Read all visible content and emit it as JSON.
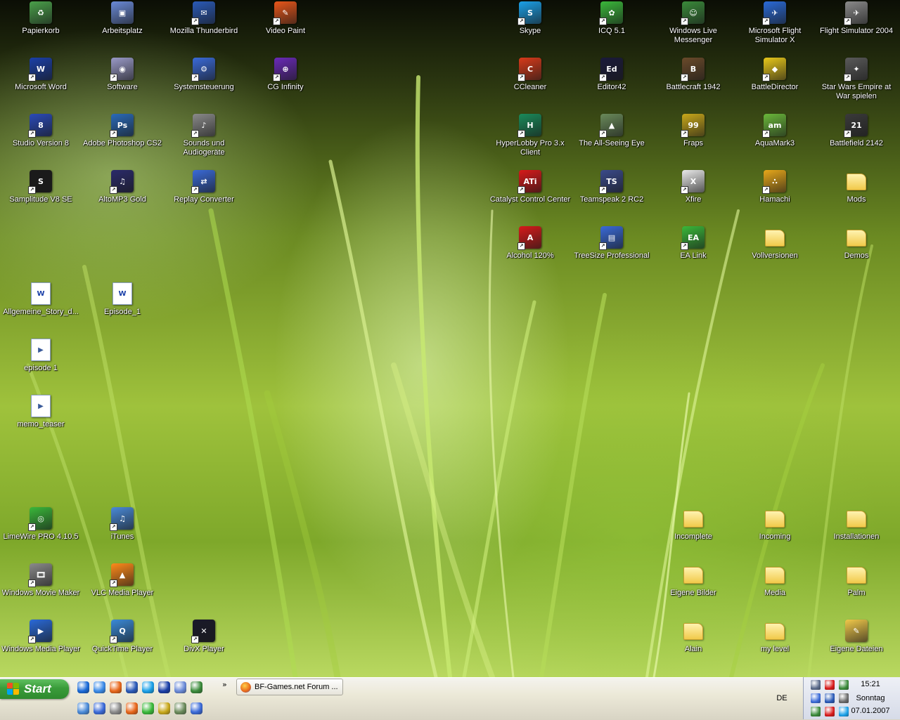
{
  "desktop": {
    "left_icons": [
      {
        "label": "Papierkorb",
        "kind": "recycle",
        "color": "#4aa04a"
      },
      {
        "label": "Arbeitsplatz",
        "kind": "computer",
        "color": "#6a8ad8"
      },
      {
        "label": "Mozilla Thunderbird",
        "kind": "thunderbird",
        "color": "#2a5ab8"
      },
      {
        "label": "Video Paint",
        "kind": "videopaint",
        "color": "#e8561a"
      },
      {
        "label": "Microsoft Word",
        "kind": "word",
        "color": "#1a3fa8"
      },
      {
        "label": "Software",
        "kind": "software",
        "color": "#9a9ac8"
      },
      {
        "label": "Systemsteuerung",
        "kind": "controlpanel",
        "color": "#3a6ad8"
      },
      {
        "label": "CG Infinity",
        "kind": "cginfinity",
        "color": "#6a2ab8"
      },
      {
        "label": "Studio Version 8",
        "kind": "studio",
        "color": "#2a4ab8"
      },
      {
        "label": "Adobe Photoshop CS2",
        "kind": "photoshop",
        "color": "#2a6ab8"
      },
      {
        "label": "Sounds und Audiogeräte",
        "kind": "sounds",
        "color": "#8a8a8a"
      },
      {
        "label": "Samplitude V8 SE",
        "kind": "samplitude",
        "color": "#1a1a1a"
      },
      {
        "label": "AltoMP3 Gold",
        "kind": "altomp3",
        "color": "#2a2a6a"
      },
      {
        "label": "Replay Converter",
        "kind": "replay",
        "color": "#3a6ad8"
      },
      {
        "label": "Allgemeine_Story_d...",
        "kind": "doc",
        "color": "#1a3fa8"
      },
      {
        "label": "Episode_1",
        "kind": "doc",
        "color": "#1a3fa8"
      },
      {
        "label": "episode 1",
        "kind": "wmv",
        "color": "#3a5a9a"
      },
      {
        "label": "memo_teaser",
        "kind": "wmv",
        "color": "#3a5a9a"
      },
      {
        "label": "LimeWire PRO 4.10.5",
        "kind": "limewire",
        "color": "#3ab83a"
      },
      {
        "label": "iTunes",
        "kind": "itunes",
        "color": "#4a8ad8"
      },
      {
        "label": "Windows Movie Maker",
        "kind": "moviemaker",
        "color": "#8a8a8a"
      },
      {
        "label": "VLC Media Player",
        "kind": "vlc",
        "color": "#ff8a1a"
      },
      {
        "label": "Windows Media Player",
        "kind": "wmp",
        "color": "#2a6ad8"
      },
      {
        "label": "QuickTime Player",
        "kind": "quicktime",
        "color": "#3a8ad8"
      },
      {
        "label": "DivX Player",
        "kind": "divx",
        "color": "#1a1a2a"
      }
    ],
    "right_icons": [
      {
        "label": "Skype",
        "kind": "skype",
        "color": "#1aa0e8"
      },
      {
        "label": "ICQ 5.1",
        "kind": "icq",
        "color": "#3ab83a"
      },
      {
        "label": "Windows Live Messenger",
        "kind": "messenger",
        "color": "#3a8a3a"
      },
      {
        "label": "Microsoft Flight Simulator X",
        "kind": "fsx",
        "color": "#2a6ad8"
      },
      {
        "label": "Flight Simulator 2004",
        "kind": "fs2004",
        "color": "#8a8a8a"
      },
      {
        "label": "CCleaner",
        "kind": "ccleaner",
        "color": "#d83a1a"
      },
      {
        "label": "Editor42",
        "kind": "editor42",
        "color": "#1a1a3a"
      },
      {
        "label": "Battlecraft 1942",
        "kind": "battlecraft",
        "color": "#6a4a2a"
      },
      {
        "label": "BattleDirector",
        "kind": "battledirector",
        "color": "#e8c81a"
      },
      {
        "label": "Star Wars Empire at War spielen",
        "kind": "empire",
        "color": "#5a5a5a"
      },
      {
        "label": "HyperLobby Pro 3.x Client",
        "kind": "hyperlobby",
        "color": "#1a8a5a"
      },
      {
        "label": "The All-Seeing Eye",
        "kind": "allseeing",
        "color": "#6a8a5a"
      },
      {
        "label": "Fraps",
        "kind": "fraps",
        "color": "#c8a81a"
      },
      {
        "label": "AquaMark3",
        "kind": "aquamark",
        "color": "#6ab83a"
      },
      {
        "label": "Battlefield 2142",
        "kind": "bf2142",
        "color": "#3a3a3a"
      },
      {
        "label": "Catalyst Control Center",
        "kind": "ati",
        "color": "#d81a1a"
      },
      {
        "label": "Teamspeak 2 RC2",
        "kind": "teamspeak",
        "color": "#3a4a8a"
      },
      {
        "label": "Xfire",
        "kind": "xfire",
        "color": "#eaeaea"
      },
      {
        "label": "Hamachi",
        "kind": "hamachi",
        "color": "#e8a81a"
      },
      {
        "label": "Mods",
        "kind": "folder",
        "color": "#f1c94a"
      },
      {
        "label": "Alcohol 120%",
        "kind": "alcohol",
        "color": "#d81a1a"
      },
      {
        "label": "TreeSize Professional",
        "kind": "treesize",
        "color": "#3a6ad8"
      },
      {
        "label": "EA Link",
        "kind": "ealink",
        "color": "#3ab83a"
      },
      {
        "label": "Vollversionen",
        "kind": "folder",
        "color": "#f1c94a"
      },
      {
        "label": "Demos",
        "kind": "folder",
        "color": "#f1c94a"
      },
      {
        "label": "Incomplete",
        "kind": "folder",
        "color": "#f1c94a"
      },
      {
        "label": "Incoming",
        "kind": "folder",
        "color": "#f1c94a"
      },
      {
        "label": "Installationen",
        "kind": "folder",
        "color": "#f1c94a"
      },
      {
        "label": "Eigene Bilder",
        "kind": "folder",
        "color": "#f1c94a"
      },
      {
        "label": "Media",
        "kind": "folder",
        "color": "#f1c94a"
      },
      {
        "label": "Palm",
        "kind": "folder",
        "color": "#f1c94a"
      },
      {
        "label": "Alain",
        "kind": "folder",
        "color": "#f1c94a"
      },
      {
        "label": "my level",
        "kind": "folder",
        "color": "#f1c94a"
      },
      {
        "label": "Eigene Dateien",
        "kind": "mydocs",
        "color": "#f1c94a"
      }
    ]
  },
  "taskbar": {
    "start_label": "Start",
    "quicklaunch_top": [
      {
        "name": "ie-icon",
        "color": "#1a6ad8"
      },
      {
        "name": "ie-icon",
        "color": "#3a8ae8"
      },
      {
        "name": "firefox-icon",
        "color": "#e8661a"
      },
      {
        "name": "thunderbird-icon",
        "color": "#2a5ab8"
      },
      {
        "name": "skype-icon",
        "color": "#1aa0e8"
      },
      {
        "name": "word-icon",
        "color": "#1a3fa8"
      },
      {
        "name": "computer-icon",
        "color": "#6a8ad8"
      },
      {
        "name": "messenger-icon",
        "color": "#3a8a3a"
      }
    ],
    "quicklaunch_bottom": [
      {
        "name": "itunes-icon",
        "color": "#4a8ad8"
      },
      {
        "name": "search-icon",
        "color": "#3a6ad8"
      },
      {
        "name": "sounds-icon",
        "color": "#8a8a8a"
      },
      {
        "name": "firefox-icon",
        "color": "#e8661a"
      },
      {
        "name": "limewire-icon",
        "color": "#3ab83a"
      },
      {
        "name": "tool-icon",
        "color": "#c8a81a"
      },
      {
        "name": "allseeing-icon",
        "color": "#6a8a5a"
      },
      {
        "name": "replay-icon",
        "color": "#3a6ad8"
      }
    ],
    "chevron": "»",
    "task_button": "BF-Games.net Forum ...",
    "language": "DE"
  },
  "tray": {
    "icons": [
      {
        "name": "network-icon",
        "color": "#5a6a8a"
      },
      {
        "name": "ati-icon",
        "color": "#d81a1a"
      },
      {
        "name": "messenger-icon",
        "color": "#3a8a3a"
      },
      {
        "name": "connection-icon",
        "color": "#3a6ad8"
      },
      {
        "name": "update-icon",
        "color": "#2a5ab8"
      },
      {
        "name": "speaker-icon",
        "color": "#6a6a6a"
      },
      {
        "name": "antivirus-icon",
        "color": "#3a8a3a"
      },
      {
        "name": "alert-icon",
        "color": "#d81a1a"
      },
      {
        "name": "skype-icon",
        "color": "#1aa0e8"
      }
    ],
    "time": "15:21",
    "day": "Sonntag",
    "date": "07.01.2007"
  }
}
